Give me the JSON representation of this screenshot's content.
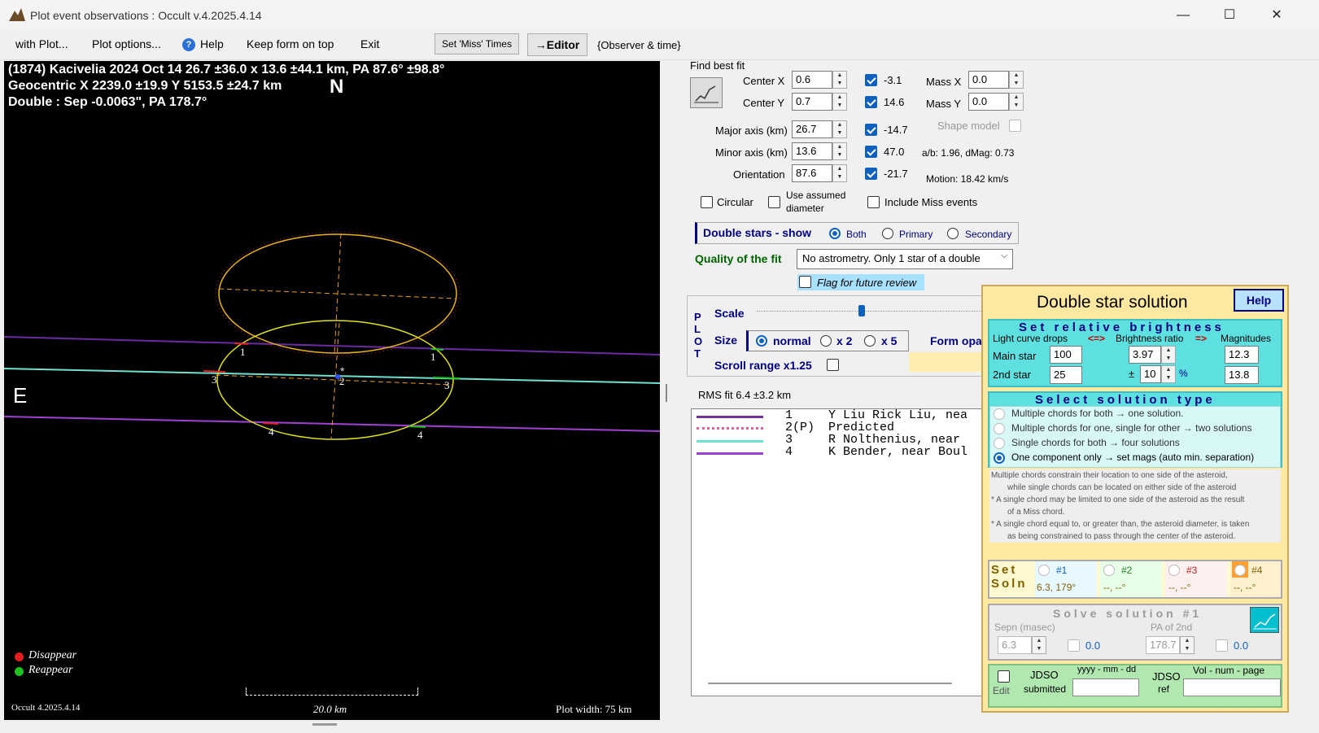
{
  "window": {
    "title": "Plot event observations : Occult v.4.2025.4.14",
    "min": "—",
    "max": "☐",
    "close": "✕"
  },
  "menu": {
    "with_plot": "with Plot...",
    "plot_options": "Plot options...",
    "help": "Help",
    "keep_form": "Keep form on top",
    "exit": "Exit",
    "set_miss": "Set 'Miss' Times",
    "editor": "→Editor",
    "observer": "{Observer & time}"
  },
  "plot": {
    "line1": "(1874) Kacivelia  2024 Oct 14   26.7 ±36.0 x 13.6 ±44.1 km, PA 87.6° ±98.8°",
    "line2": "Geocentric  X 2239.0 ±19.9  Y 5153.5 ±24.7 km",
    "north": "N",
    "east": "E",
    "line3": "Double : Sep  -0.0063\", PA 178.7°",
    "disappear": "Disappear",
    "reappear": "Reappear",
    "version": "Occult 4.2025.4.14",
    "scale": "20.0 km",
    "width": "Plot width: 75 km",
    "chord_labels": [
      "1",
      "1",
      "3",
      "2",
      "3",
      "4",
      "4"
    ]
  },
  "fit": {
    "heading": "Find best fit",
    "cx_label": "Center X",
    "cx": "0.6",
    "cy_label": "Center Y",
    "cy": "0.7",
    "major_label": "Major axis (km)",
    "major": "26.7",
    "minor_label": "Minor axis (km)",
    "minor": "13.6",
    "orient_label": "Orientation",
    "orient": "87.6",
    "v1": "-3.1",
    "v2": "14.6",
    "v3": "-14.7",
    "v4": "47.0",
    "v5": "-21.7",
    "massx_label": "Mass X",
    "massx": "0.0",
    "massy_label": "Mass Y",
    "massy": "0.0",
    "shape": "Shape model",
    "ab": "a/b: 1.96, dMag: 0.73",
    "motion": "Motion: 18.42 km/s",
    "circular": "Circular",
    "assumed": "Use assumed",
    "diameter": "diameter",
    "include_miss": "Include Miss events"
  },
  "double": {
    "label": "Double stars - show",
    "both": "Both",
    "primary": "Primary",
    "secondary": "Secondary"
  },
  "quality": {
    "label": "Quality of the fit",
    "value": "No astrometry. Only 1 star of a double",
    "flag": "Flag for future review"
  },
  "plotctl": {
    "side": "P L O T",
    "scale": "Scale",
    "size": "Size",
    "normal": "normal",
    "x2": "x 2",
    "x5": "x 5",
    "form_opa": "Form opa",
    "scroll": "Scroll range x1.25"
  },
  "rms": "RMS fit 6.4 ±3.2 km",
  "legend": [
    {
      "num": "1",
      "name": "Y Liu Rick Liu, nea",
      "color": "#7030a0"
    },
    {
      "num": "2(P)",
      "name": "Predicted",
      "color": "#e060a0"
    },
    {
      "num": "3",
      "name": "R Nolthenius, near",
      "color": "#70e0d0"
    },
    {
      "num": "4",
      "name": "K Bender, near Boul",
      "color": "#a040d0"
    }
  ],
  "dss": {
    "title": "Double star solution",
    "help": "Help",
    "srb": "Set  relative  brightness",
    "lcd": "Light curve drops",
    "arrow1": "<=>",
    "br": "Brightness ratio",
    "arrow2": "=>",
    "mags": "Magnitudes",
    "main": "Main star",
    "main_drop": "100",
    "ratio": "3.97",
    "mag1": "12.3",
    "second": "2nd star",
    "second_drop": "25",
    "pm": "±",
    "pct": "10",
    "pctsym": "%",
    "mag2": "13.8",
    "sst": "Select  solution  type",
    "opt1": "Multiple chords for both → one solution.",
    "opt2": "Multiple chords for one, single for other → two solutions",
    "opt3": "Single chords for both → four solutions",
    "opt4": "One component only → set mags (auto min. separation)",
    "note1": "Multiple chords constrain their location to one side of the asteroid,",
    "note2": "while single chords can be located on either side of the asteroid",
    "note3": "* A single chord may be limited to one side of the asteroid as the result",
    "note4": "of a Miss chord.",
    "note5": "* A single chord equal to, or greater than, the asteroid diameter, is taken",
    "note6": "as being constrained to pass through the center of the asteroid.",
    "setsoln": "Set Soln",
    "s1": "#1",
    "s2": "#2",
    "s3": "#3",
    "s4": "#4",
    "s1v": "6.3, 179°",
    "s2v": "--, --°",
    "s3v": "--, --°",
    "s4v": "--, --°",
    "solve": "Solve  solution  #1",
    "sepn": "Sepn (masec)",
    "sepv": "6.3",
    "sep0": "0.0",
    "pa": "PA of 2nd",
    "pav": "178.7",
    "pa0": "0.0",
    "edit": "Edit",
    "jdso": "JDSO",
    "submitted": "submitted",
    "date": "yyyy - mm - dd",
    "jdso2": "JDSO",
    "ref": "ref",
    "vol": "Vol - num - page"
  },
  "colors": {
    "accent": "#1060c0",
    "fit_green": "#006400",
    "navy": "#000080"
  }
}
